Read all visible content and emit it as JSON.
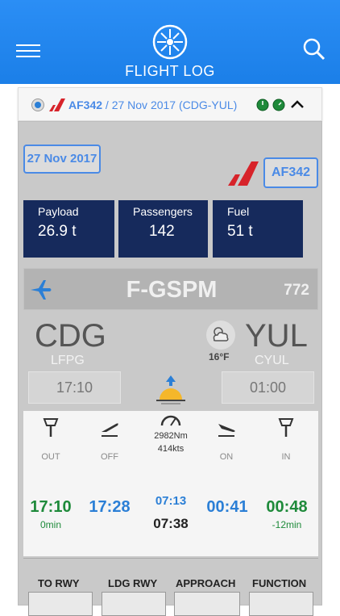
{
  "header": {
    "title": "FLIGHT LOG"
  },
  "flight_bar": {
    "flight_no": "AF342",
    "summary": " / 27 Nov 2017 (CDG-YUL)"
  },
  "card": {
    "date": "27 Nov 2017",
    "flight_no": "AF342",
    "stats": [
      {
        "label": "Payload",
        "value": "26.9 t"
      },
      {
        "label": "Passengers",
        "value": "142"
      },
      {
        "label": "Fuel",
        "value": "51 t"
      }
    ],
    "registration": "F-GSPM",
    "reg_number": "772",
    "origin": {
      "code": "CDG",
      "icao": "LFPG",
      "time": "17:10"
    },
    "destination": {
      "code": "YUL",
      "icao": "CYUL",
      "time": "01:00"
    },
    "temperature": "16°F",
    "events": {
      "out": "OUT",
      "off": "OFF",
      "on": "ON",
      "in": "IN",
      "distance": "2982Nm",
      "speed": "414kts"
    },
    "times": {
      "out": "17:10",
      "out_sub": "0min",
      "off": "17:28",
      "mid_top": "07:13",
      "mid_bottom": "07:38",
      "on": "00:41",
      "in": "00:48",
      "in_sub": "-12min"
    },
    "bottom": {
      "to_rwy": "TO RWY",
      "ldg_rwy": "LDG RWY",
      "approach": "APPROACH",
      "function": "FUNCTION"
    }
  },
  "colors": {
    "header": "#1b7fe8",
    "stat_bg": "#162a5c",
    "accent": "#4a8ae6",
    "green": "#1e8a3a"
  }
}
